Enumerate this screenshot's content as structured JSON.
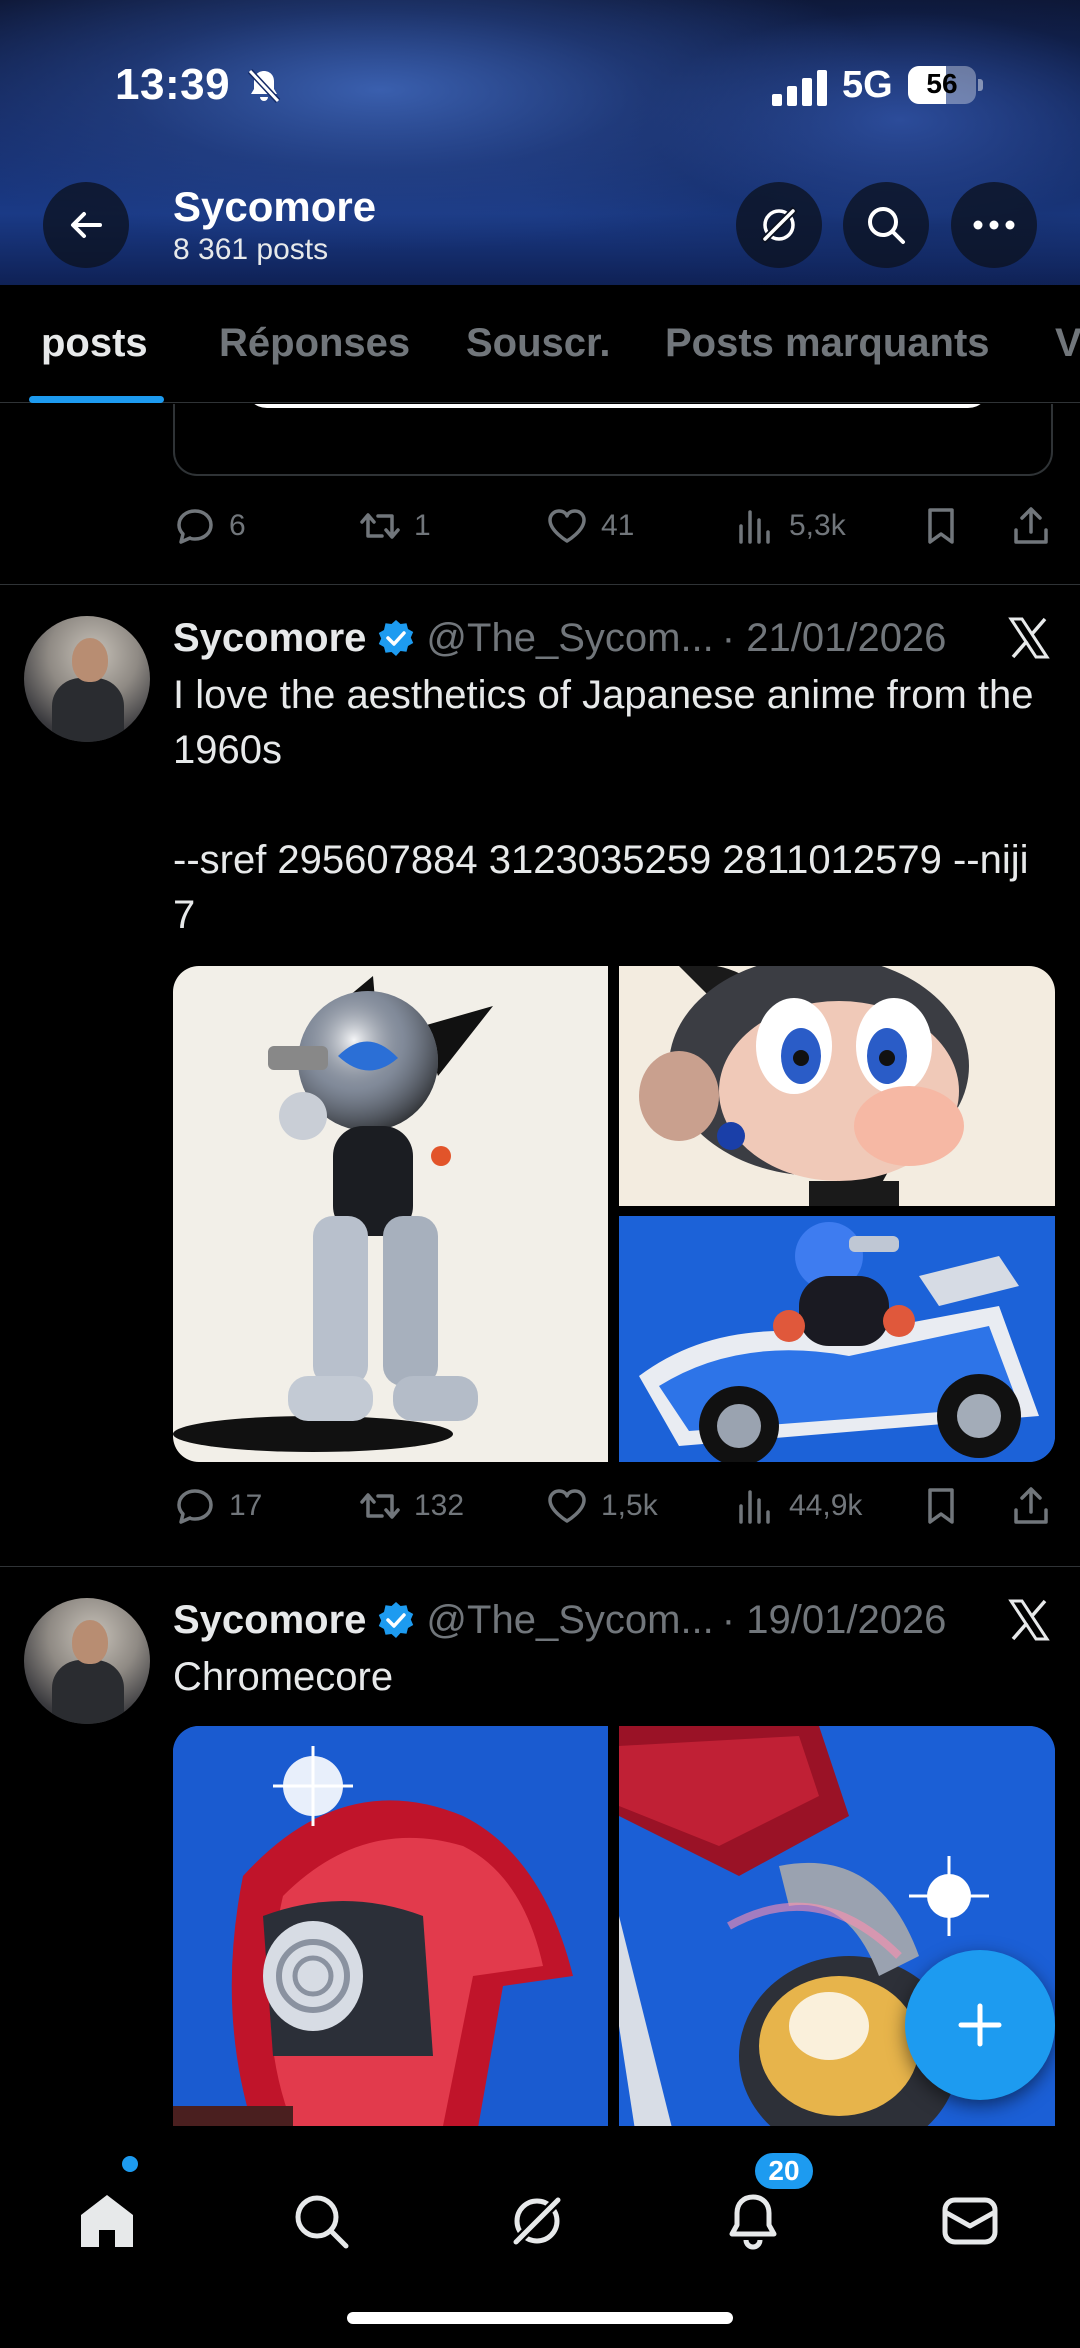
{
  "status_bar": {
    "time": "13:39",
    "network": "5G",
    "battery": "56",
    "battery_level": 0.56
  },
  "header": {
    "name": "Sycomore",
    "post_count": "8 361 posts"
  },
  "tabs": [
    {
      "label": "posts",
      "active": true
    },
    {
      "label": "Réponses"
    },
    {
      "label": "Souscr."
    },
    {
      "label": "Posts marquants"
    },
    {
      "label": "V"
    }
  ],
  "prev_post": {
    "replies": "6",
    "reposts": "1",
    "likes": "41",
    "views": "5,3k"
  },
  "posts": [
    {
      "name": "Sycomore",
      "handle": "@The_Sycom...",
      "date": "· 21/01/2026",
      "text": "I love the aesthetics of Japanese anime from the 1960s\n\n--sref 295607884 3123035259 2811012579 --niji 7",
      "replies": "17",
      "reposts": "132",
      "likes": "1,5k",
      "views": "44,9k"
    },
    {
      "name": "Sycomore",
      "handle": "@The_Sycom...",
      "date": "· 19/01/2026",
      "text": "Chromecore"
    }
  ],
  "bottom_nav": {
    "notifications_badge": "20"
  },
  "colors": {
    "accent": "#1d9bf0",
    "muted": "#71767b",
    "text": "#e7e9ea",
    "background": "#000000"
  },
  "icons": [
    "back-icon",
    "compass-icon",
    "search-icon",
    "more-icon",
    "reply-icon",
    "repost-icon",
    "like-icon",
    "views-icon",
    "bookmark-icon",
    "share-icon",
    "verified-icon",
    "x-logo-icon",
    "compose-icon",
    "home-icon",
    "notifications-icon",
    "messages-icon"
  ]
}
